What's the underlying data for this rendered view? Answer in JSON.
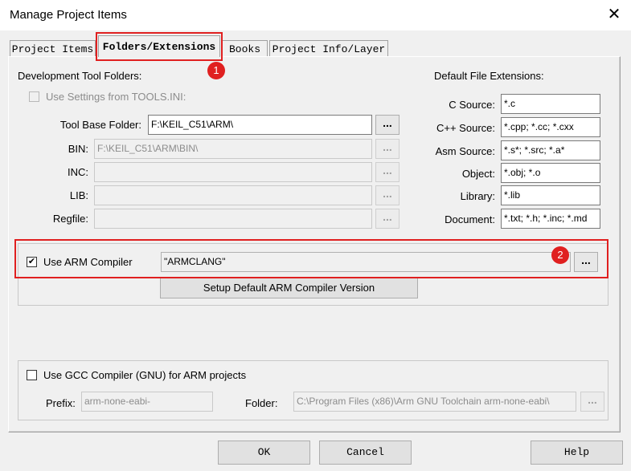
{
  "window": {
    "title": "Manage Project Items",
    "close_glyph": "✕"
  },
  "tabs": [
    {
      "label": "Project Items"
    },
    {
      "label": "Folders/Extensions"
    },
    {
      "label": "Books"
    },
    {
      "label": "Project Info/Layer"
    }
  ],
  "annotations": {
    "badge1": "1",
    "badge2": "2",
    "accent": "#e02020"
  },
  "dev_folders": {
    "heading": "Development Tool Folders:",
    "use_tools_ini_label": "Use Settings from TOOLS.INI:",
    "tool_base_label": "Tool Base Folder:",
    "tool_base_value": "F:\\KEIL_C51\\ARM\\",
    "bin_label": "BIN:",
    "bin_value": "F:\\KEIL_C51\\ARM\\BIN\\",
    "inc_label": "INC:",
    "inc_value": "",
    "lib_label": "LIB:",
    "lib_value": "",
    "regfile_label": "Regfile:",
    "regfile_value": "",
    "browse_glyph": "..."
  },
  "extensions": {
    "heading": "Default File Extensions:",
    "rows": [
      {
        "label": "C Source:",
        "value": "*.c"
      },
      {
        "label": "C++ Source:",
        "value": "*.cpp; *.cc; *.cxx"
      },
      {
        "label": "Asm Source:",
        "value": "*.s*; *.src; *.a*"
      },
      {
        "label": "Object:",
        "value": "*.obj; *.o"
      },
      {
        "label": "Library:",
        "value": "*.lib"
      },
      {
        "label": "Document:",
        "value": "*.txt; *.h; *.inc; *.md"
      }
    ]
  },
  "arm_compiler": {
    "checkbox_label": "Use ARM Compiler",
    "checked_glyph": "✔",
    "value": "\"ARMCLANG\"",
    "setup_button": "Setup Default ARM Compiler Version"
  },
  "gcc": {
    "checkbox_label": "Use GCC Compiler (GNU) for ARM projects",
    "prefix_label": "Prefix:",
    "prefix_value": "arm-none-eabi-",
    "folder_label": "Folder:",
    "folder_value": "C:\\Program Files (x86)\\Arm GNU Toolchain arm-none-eabi\\"
  },
  "buttons": {
    "ok": "OK",
    "cancel": "Cancel",
    "help": "Help"
  }
}
